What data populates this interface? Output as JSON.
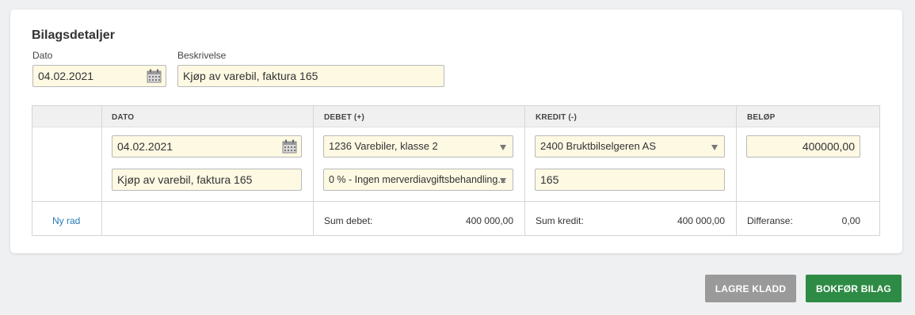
{
  "card": {
    "title": "Bilagsdetaljer",
    "date_label": "Dato",
    "date_value": "04.02.2021",
    "desc_label": "Beskrivelse",
    "desc_value": "Kjøp av varebil, faktura 165"
  },
  "grid": {
    "headers": [
      "DATO",
      "DEBET (+)",
      "KREDIT (-)",
      "BELØP"
    ],
    "row": {
      "date": "04.02.2021",
      "description": "Kjøp av varebil, faktura 165",
      "debet_account": "1236 Varebiler, klasse 2",
      "vat_code": "0 % - Ingen merverdiavgiftsbehandling...",
      "kredit_account": "2400 Bruktbilselgeren AS",
      "kredit_ref": "165",
      "amount": "400000,00"
    },
    "footer": {
      "new_row": "Ny rad",
      "sum_debet_label": "Sum debet:",
      "sum_debet_value": "400 000,00",
      "sum_kredit_label": "Sum kredit:",
      "sum_kredit_value": "400 000,00",
      "diff_label": "Differanse:",
      "diff_value": "0,00"
    }
  },
  "actions": {
    "save_draft": "LAGRE KLADD",
    "post": "BOKFØR BILAG"
  },
  "icons": {
    "calendar": "calendar-icon",
    "dropdown": "chevron-down-icon"
  },
  "colors": {
    "input_bg": "#fdf9e3",
    "link": "#2a7ab8",
    "primary": "#2e8b46",
    "secondary": "#9a9a9a"
  }
}
